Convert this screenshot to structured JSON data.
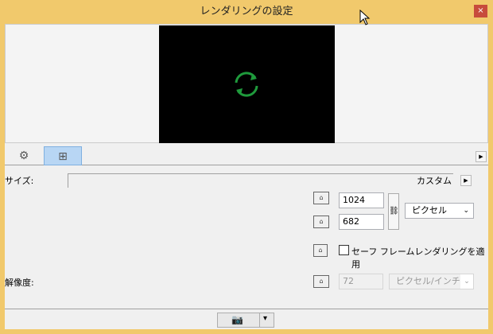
{
  "window": {
    "title": "レンダリングの設定",
    "close": "×"
  },
  "tabs": [
    {
      "name": "settings",
      "icon": "⚙"
    },
    {
      "name": "size",
      "icon": "⊞"
    }
  ],
  "size": {
    "label": "サイズ:",
    "preset": "カスタム",
    "width": "1024",
    "height": "682",
    "unit": "ピクセル",
    "safe_frame": "セーフ フレームレンダリングを適用",
    "safe_frame_checked": false
  },
  "resolution": {
    "label": "解像度:",
    "value": "72",
    "unit": "ピクセル/インチ"
  },
  "footer": {
    "camera": "📷",
    "arrow": "▾"
  },
  "colors": {
    "frame": "#f1c96c",
    "spinner": "#1f9a3c",
    "tab_active": "#b8d6f4"
  }
}
